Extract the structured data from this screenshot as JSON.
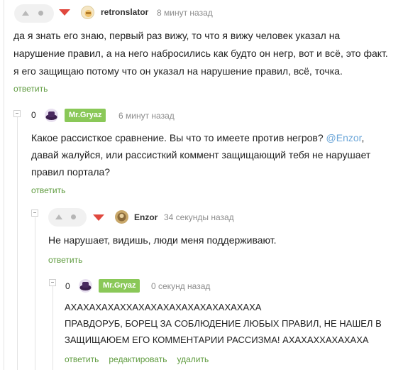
{
  "comments": [
    {
      "author": "retronslator",
      "time": "8 минут назад",
      "lines": [
        "да я знать его знаю, первый раз вижу, то что я вижу человек указал на",
        "нарушение правил, а на него набросились как будто он негр, вот и всё, это факт.",
        "я его защищаю потому что он указал на нарушение правил, всё, точка."
      ],
      "actions": {
        "reply": "ответить"
      }
    },
    {
      "rating": "0",
      "author": "Mr.Gryaz",
      "time": "6 минут назад",
      "lines": [
        "Какое рассисткое сравнение. Вы что то имеете против негров?",
        "давай жалуйся, или рассисткий коммент защищающий тебя не нарушает",
        "правил портала?"
      ],
      "mention": "@Enzor",
      "mention_suffix": ",",
      "actions": {
        "reply": "ответить"
      }
    },
    {
      "author": "Enzor",
      "time": "34 секунды назад",
      "lines": [
        "Не нарушает, видишь, люди меня поддерживают."
      ],
      "actions": {
        "reply": "ответить"
      }
    },
    {
      "rating": "0",
      "author": "Mr.Gryaz",
      "time": "0 секунд назад",
      "lines": [
        "АХАХАХАХАХХАХАХАХАХАХАХАХАХАХАХА",
        "ПРАВДОРУБ, БОРЕЦ ЗА СОБЛЮДЕНИЕ ЛЮБЫХ ПРАВИЛ, НЕ НАШЕЛ В",
        "ЗАЩИЩАЮЕМ ЕГО КОММЕНТАРИИ РАССИЗМА! АХАХАХХАХАХАХА"
      ],
      "actions": {
        "reply": "ответить",
        "edit": "редактировать",
        "delete": "удалить"
      }
    }
  ],
  "colors": {
    "link": "#5f9b3f",
    "author_badge": "#8ac858",
    "downvote": "#e0483e",
    "mention": "#6aa5d8"
  }
}
